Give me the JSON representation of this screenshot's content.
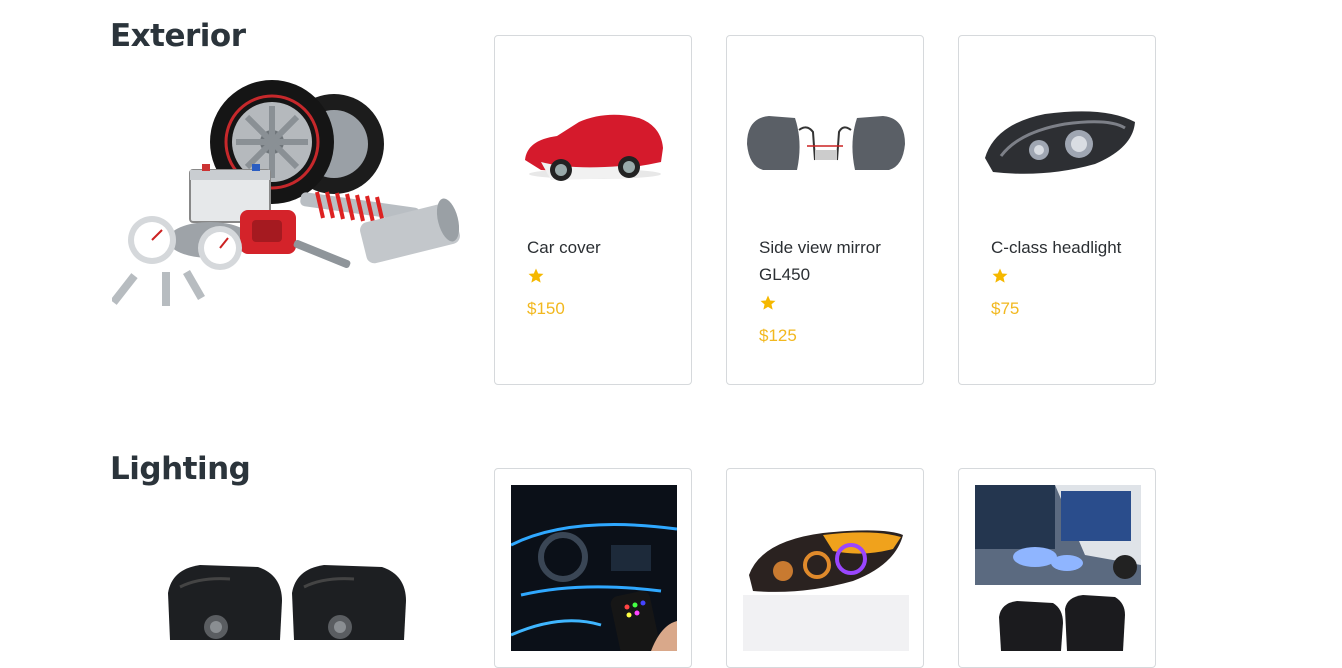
{
  "sections": [
    {
      "title": "Exterior",
      "products": [
        {
          "name": "Car cover",
          "rating": 1,
          "price": "$150"
        },
        {
          "name": "Side view mirror GL450",
          "rating": 1,
          "price": "$125"
        },
        {
          "name": "C-class headlight",
          "rating": 1,
          "price": "$75"
        }
      ]
    },
    {
      "title": "Lighting",
      "products": [
        {
          "name": "",
          "rating": null,
          "price": ""
        },
        {
          "name": "",
          "rating": null,
          "price": ""
        },
        {
          "name": "",
          "rating": null,
          "price": ""
        }
      ]
    }
  ],
  "icons": {
    "rating": "star-icon"
  },
  "colors": {
    "star": "#f5b800",
    "price": "#f2b81f",
    "heading": "#2b343b",
    "card_border": "#d6d9dc"
  }
}
